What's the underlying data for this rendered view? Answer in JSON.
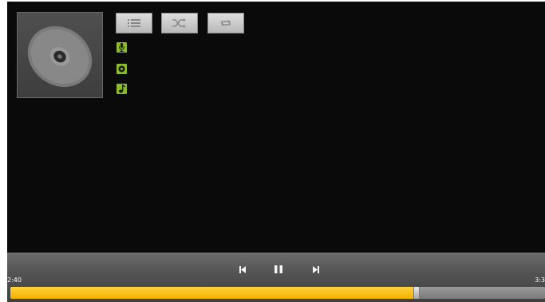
{
  "album_art": {
    "icon": "disc-icon"
  },
  "toolbar": {
    "playlist_icon": "playlist-icon",
    "shuffle_icon": "shuffle-icon",
    "repeat_icon": "repeat-icon"
  },
  "track": {
    "artist_icon": "microphone-icon",
    "artist": "",
    "album_icon": "album-icon",
    "album": "",
    "title_icon": "music-note-icon",
    "title": ""
  },
  "controls": {
    "previous_icon": "previous-icon",
    "pause_icon": "pause-icon",
    "next_icon": "next-icon"
  },
  "progress": {
    "current_time": "2:40",
    "total_time": "3:3",
    "fraction": 0.755
  },
  "colors": {
    "accent": "#f6c11a",
    "icon_green": "#8cb92d",
    "background": "#0a0a0a"
  }
}
